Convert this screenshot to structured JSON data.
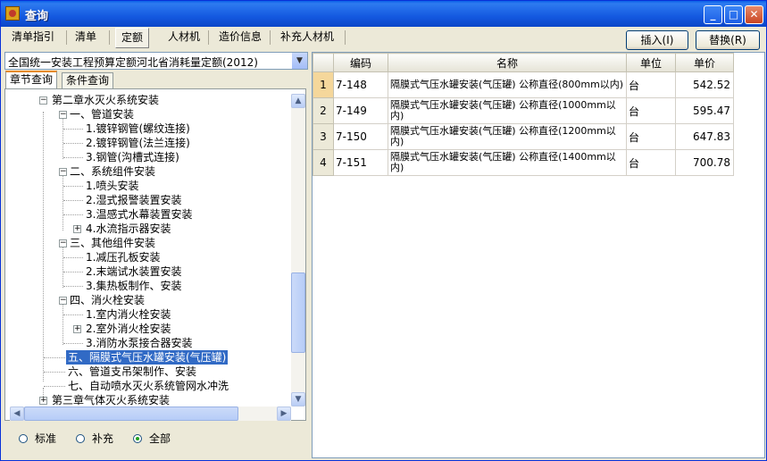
{
  "window": {
    "title": "查询"
  },
  "toolbar": {
    "tabs": [
      {
        "label": "清单指引"
      },
      {
        "label": "清单"
      },
      {
        "label": "定额"
      },
      {
        "label": "人材机"
      },
      {
        "label": "造价信息"
      },
      {
        "label": "补充人材机"
      }
    ],
    "insert_label": "插入(I)",
    "replace_label": "替换(R)"
  },
  "quota_library": {
    "selected": "全国统一安装工程预算定额河北省消耗量定额(2012)"
  },
  "left_tabs": [
    {
      "label": "章节查询"
    },
    {
      "label": "条件查询"
    }
  ],
  "tree": [
    {
      "label": "第二章水灭火系统安装"
    },
    {
      "label": "一、管道安装"
    },
    {
      "label": "1.镀锌钢管(螺纹连接)"
    },
    {
      "label": "2.镀锌钢管(法兰连接)"
    },
    {
      "label": "3.钢管(沟槽式连接)"
    },
    {
      "label": "二、系统组件安装"
    },
    {
      "label": "1.喷头安装"
    },
    {
      "label": "2.湿式报警装置安装"
    },
    {
      "label": "3.温感式水幕装置安装"
    },
    {
      "label": "4.水流指示器安装"
    },
    {
      "label": "三、其他组件安装"
    },
    {
      "label": "1.减压孔板安装"
    },
    {
      "label": "2.末端试水装置安装"
    },
    {
      "label": "3.集热板制作、安装"
    },
    {
      "label": "四、消火栓安装"
    },
    {
      "label": "1.室内消火栓安装"
    },
    {
      "label": "2.室外消火栓安装"
    },
    {
      "label": "3.消防水泵接合器安装"
    },
    {
      "label": "五、隔膜式气压水罐安装(气压罐)"
    },
    {
      "label": "六、管道支吊架制作、安装"
    },
    {
      "label": "七、自动喷水灭火系统管网水冲洗"
    },
    {
      "label": "第三章气体灭火系统安装"
    }
  ],
  "filter": {
    "options": [
      {
        "label": "标准"
      },
      {
        "label": "补充"
      },
      {
        "label": "全部"
      }
    ],
    "selected": "全部"
  },
  "grid": {
    "columns": [
      "编码",
      "名称",
      "单位",
      "单价"
    ],
    "rows": [
      {
        "index": "1",
        "code": "7-148",
        "name": "隔膜式气压水罐安装(气压罐) 公称直径(800mm以内)",
        "unit": "台",
        "price": "542.52"
      },
      {
        "index": "2",
        "code": "7-149",
        "name": "隔膜式气压水罐安装(气压罐) 公称直径(1000mm以内)",
        "unit": "台",
        "price": "595.47"
      },
      {
        "index": "3",
        "code": "7-150",
        "name": "隔膜式气压水罐安装(气压罐) 公称直径(1200mm以内)",
        "unit": "台",
        "price": "647.83"
      },
      {
        "index": "4",
        "code": "7-151",
        "name": "隔膜式气压水罐安装(气压罐) 公称直径(1400mm以内)",
        "unit": "台",
        "price": "700.78"
      }
    ]
  }
}
